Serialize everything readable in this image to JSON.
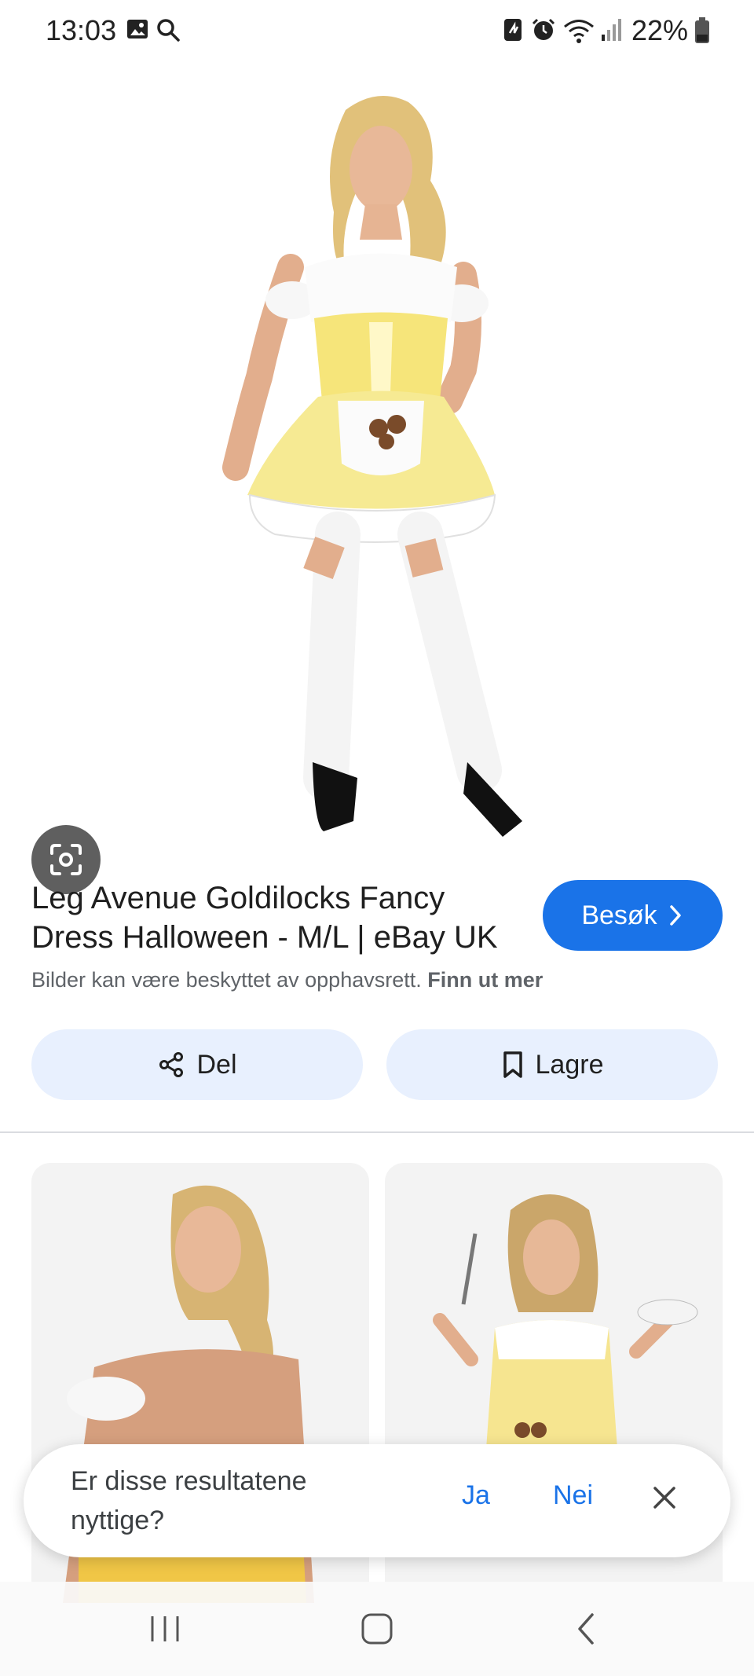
{
  "status_bar": {
    "time": "13:03",
    "battery_percent": "22%",
    "icons": [
      "gallery-icon",
      "search-icon",
      "nfc-icon",
      "alarm-icon",
      "wifi-icon",
      "signal-icon",
      "battery-icon"
    ]
  },
  "result": {
    "title": "Leg Avenue Goldilocks Fancy Dress Halloween - M/L | eBay UK",
    "visit_label": "Besøk",
    "copyright_text": "Bilder kan være beskyttet av opphavsrett.",
    "copyright_link": "Finn ut mer",
    "share_label": "Del",
    "save_label": "Lagre"
  },
  "feedback": {
    "question": "Er disse resultatene nyttige?",
    "yes": "Ja",
    "no": "Nei"
  },
  "colors": {
    "accent": "#1a73e8",
    "pill_bg": "#e8f0fe",
    "costume_yellow": "#f6e57a"
  }
}
